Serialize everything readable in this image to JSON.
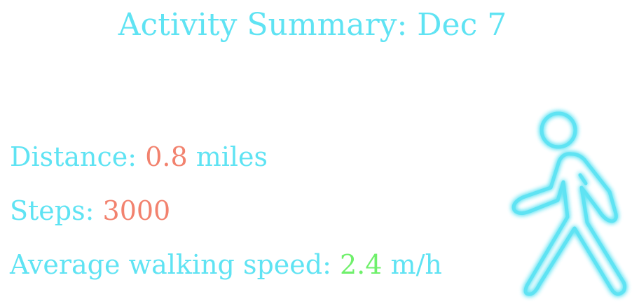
{
  "title": "Activity Summary: Dec 7",
  "stats": {
    "distance": {
      "label": "Distance:",
      "value": "0.8",
      "unit": "miles"
    },
    "steps": {
      "label": "Steps:",
      "value": "3000"
    },
    "speed": {
      "label": "Average walking speed:",
      "value": "2.4",
      "unit": "m/h"
    }
  },
  "colors": {
    "text": "#5fe3f3",
    "value_highlight": "#f2826e",
    "speed_highlight": "#6ff06b",
    "icon_glow": "#5fe3f3"
  },
  "icons": {
    "activity": "walking-person-icon"
  }
}
